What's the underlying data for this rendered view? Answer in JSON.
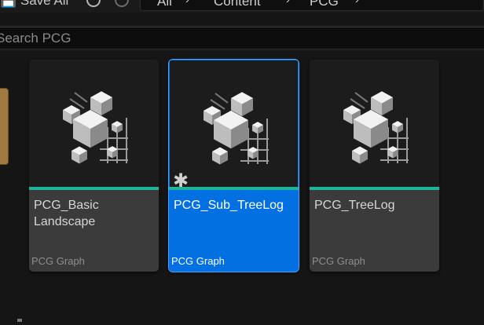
{
  "toolbar": {
    "partial_label": "Save All",
    "breadcrumbs": [
      "All",
      "Content",
      "PCG"
    ]
  },
  "search": {
    "placeholder": "Search PCG"
  },
  "assets": [
    {
      "name": "PCG_Basic Landscape",
      "type": "PCG Graph",
      "selected": false,
      "dirty": false
    },
    {
      "name": "PCG_Sub_TreeLog",
      "type": "PCG Graph",
      "selected": true,
      "dirty": true
    },
    {
      "name": "PCG_TreeLog",
      "type": "PCG Graph",
      "selected": false,
      "dirty": false
    }
  ],
  "colors": {
    "selection": "#0270e0",
    "type_stripe": "#1fb59a",
    "folder": "#a07a3f"
  },
  "icons": {
    "thumbnail": "pcg-graph-cubes-icon",
    "dirty": "asterisk-icon"
  }
}
